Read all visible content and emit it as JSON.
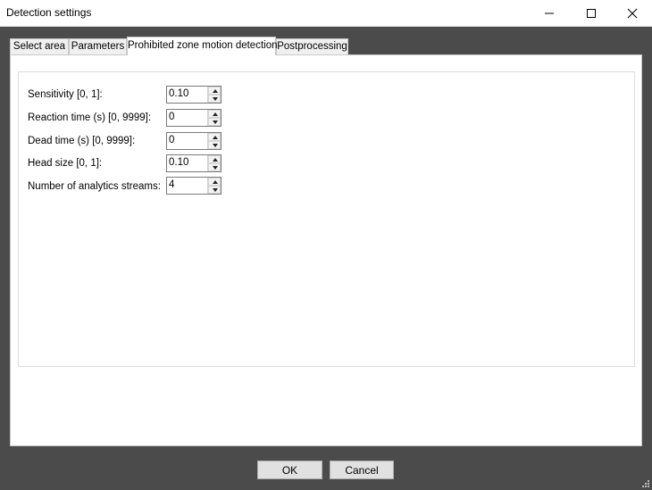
{
  "window": {
    "title": "Detection settings",
    "controls": {
      "minimize": "minimize-icon",
      "maximize": "maximize-icon",
      "close": "close-icon"
    }
  },
  "tabs": [
    {
      "label": "Select area",
      "active": false
    },
    {
      "label": "Parameters",
      "active": false
    },
    {
      "label": "Prohibited zone motion detection",
      "active": true
    },
    {
      "label": "Postprocessing",
      "active": false
    }
  ],
  "fields": [
    {
      "label": "Sensitivity [0, 1]:",
      "value": "0.10"
    },
    {
      "label": "Reaction time (s) [0, 9999]:",
      "value": "0"
    },
    {
      "label": "Dead time (s) [0, 9999]:",
      "value": "0"
    },
    {
      "label": "Head size [0, 1]:",
      "value": "0.10"
    },
    {
      "label": "Number of analytics streams:",
      "value": "4"
    }
  ],
  "buttons": {
    "ok": "OK",
    "cancel": "Cancel"
  },
  "colors": {
    "background": "#4b4b4b",
    "panel": "#ffffff",
    "button": "#e1e1e1"
  }
}
